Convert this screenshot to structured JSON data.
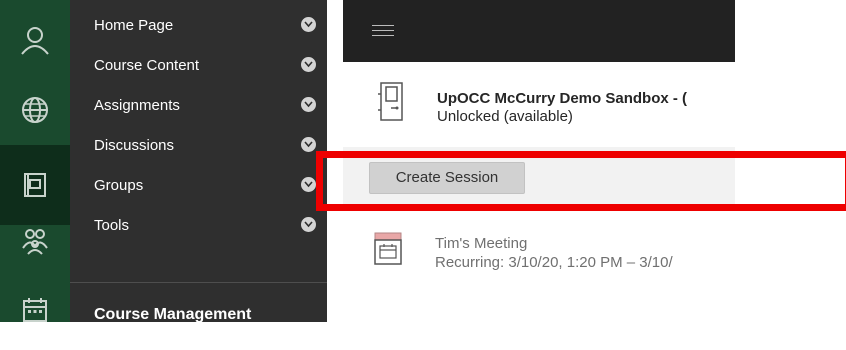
{
  "rail": {
    "icons": [
      "user-icon",
      "globe-icon",
      "courses-icon",
      "groups-icon",
      "calendar-icon"
    ]
  },
  "menu": {
    "items": [
      {
        "label": "Home Page"
      },
      {
        "label": "Course Content"
      },
      {
        "label": "Assignments"
      },
      {
        "label": "Discussions"
      },
      {
        "label": "Groups"
      },
      {
        "label": "Tools"
      }
    ],
    "section_title": "Course Management"
  },
  "content": {
    "room_title": "UpOCC McCurry Demo Sandbox - (",
    "room_status": "Unlocked (available)",
    "create_session_label": "Create Session",
    "meeting_title": "Tim's Meeting",
    "meeting_recurrence": "Recurring: 3/10/20, 1:20 PM – 3/10/"
  },
  "colors": {
    "rail": "#1a4a2e",
    "menu": "#2f2f2f",
    "topbar": "#222222",
    "highlight": "#ee0000"
  }
}
